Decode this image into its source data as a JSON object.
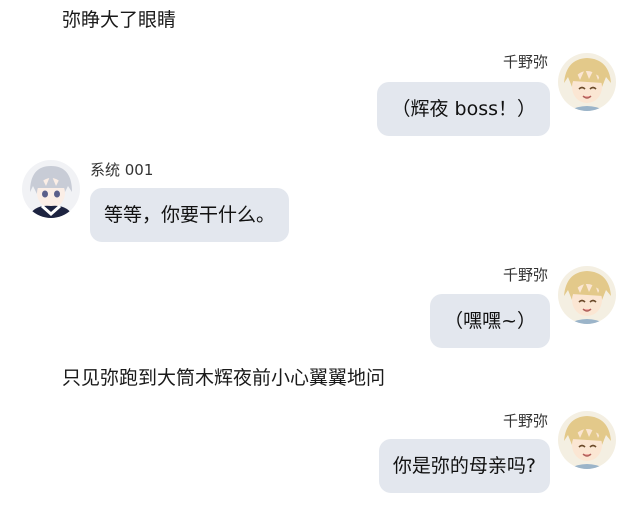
{
  "messages": [
    {
      "type": "narration",
      "text": "弥睁大了眼睛"
    },
    {
      "type": "chat",
      "side": "right",
      "sender": "千野弥",
      "text": "（辉夜 boss！）",
      "avatar": "blonde-boy-avatar"
    },
    {
      "type": "chat",
      "side": "left",
      "sender": "系统 001",
      "text": "等等，你要干什么。",
      "avatar": "silver-hair-boy-avatar"
    },
    {
      "type": "chat",
      "side": "right",
      "sender": "千野弥",
      "text": "（嘿嘿~）",
      "avatar": "blonde-boy-avatar"
    },
    {
      "type": "narration",
      "text": "只见弥跑到大筒木辉夜前小心翼翼地问"
    },
    {
      "type": "chat",
      "side": "right",
      "sender": "千野弥",
      "text": "你是弥的母亲吗?",
      "avatar": "blonde-boy-avatar"
    }
  ]
}
